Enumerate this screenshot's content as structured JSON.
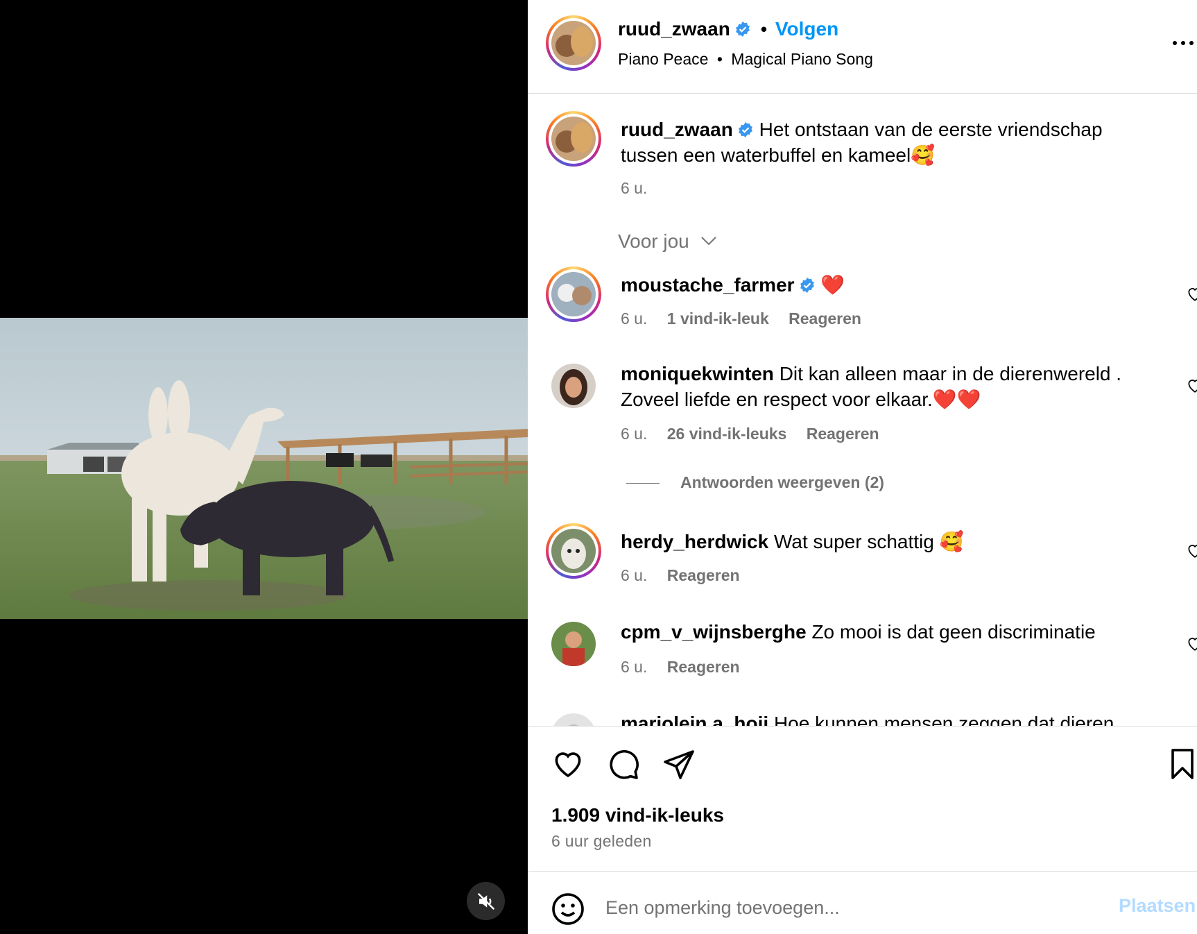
{
  "post": {
    "username": "ruud_zwaan",
    "follow_label": "Volgen",
    "header_dot": "•",
    "audio_artist": "Piano Peace",
    "audio_title": "Magical Piano Song",
    "caption": "Het ontstaan van de eerste vriendschap tussen een waterbuffel en kameel🥰",
    "caption_time": "6 u.",
    "likes": "1.909 vind-ik-leuks",
    "age": "6 uur geleden"
  },
  "comments_filter": {
    "label": "Voor jou"
  },
  "comments": [
    {
      "username": "moustache_farmer",
      "verified": true,
      "text": "❤️",
      "time": "6 u.",
      "likes": "1 vind-ik-leuk",
      "reply": "Reageren"
    },
    {
      "username": "moniquekwinten",
      "verified": false,
      "text": "Dit kan alleen maar in de dierenwereld . Zoveel liefde en respect voor elkaar.❤️❤️",
      "time": "6 u.",
      "likes": "26 vind-ik-leuks",
      "reply": "Reageren",
      "view_replies": "Antwoorden weergeven (2)"
    },
    {
      "username": "herdy_herdwick",
      "verified": false,
      "text": "Wat super schattig 🥰",
      "time": "6 u.",
      "reply": "Reageren"
    },
    {
      "username": "cpm_v_wijnsberghe",
      "verified": false,
      "text": "Zo mooi is dat geen discriminatie",
      "time": "6 u.",
      "reply": "Reageren"
    },
    {
      "username": "marjolein.a_hoij",
      "verified": false,
      "text": "Hoe kunnen mensen zeggen dat dieren"
    }
  ],
  "comment_box": {
    "placeholder": "Een opmerking toevoegen...",
    "post_label": "Plaatsen"
  },
  "colors": {
    "accent": "#0095f6",
    "verified": "#3897f0",
    "muted": "#737373",
    "post_disabled": "#b3dbff"
  },
  "icons": [
    "mute-icon",
    "more-icon",
    "verified-icon",
    "chevron-down-icon",
    "heart-icon",
    "comment-icon",
    "share-icon",
    "bookmark-icon",
    "emoji-icon"
  ]
}
